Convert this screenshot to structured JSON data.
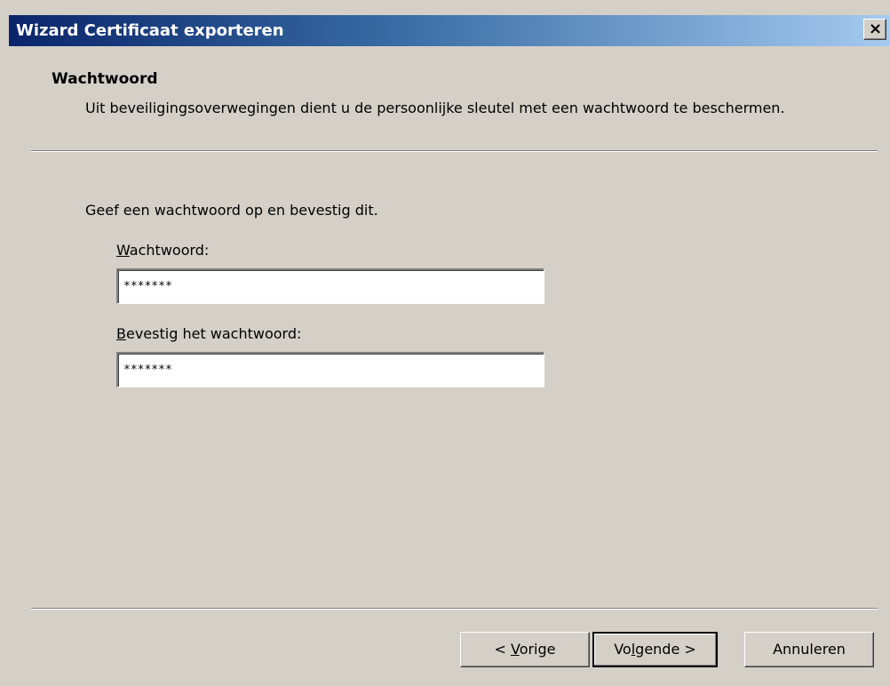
{
  "window": {
    "title": "Wizard Certificaat exporteren",
    "close_glyph": "×"
  },
  "header": {
    "heading": "Wachtwoord",
    "subtitle": "Uit beveiligingsoverwegingen dient u de persoonlijke sleutel met een wachtwoord te beschermen."
  },
  "body": {
    "intro": "Geef een wachtwoord op en bevestig dit.",
    "password": {
      "label_mnemonic": "W",
      "label_rest": "achtwoord:",
      "value": "*******"
    },
    "confirm": {
      "label_mnemonic": "B",
      "label_rest": "evestig het wachtwoord:",
      "value": "*******"
    }
  },
  "buttons": {
    "back": {
      "prefix": "< ",
      "mnemonic": "V",
      "rest": "orige"
    },
    "next": {
      "prefix": "Vo",
      "mnemonic": "l",
      "rest": "gende >"
    },
    "cancel": {
      "label": "Annuleren"
    }
  }
}
